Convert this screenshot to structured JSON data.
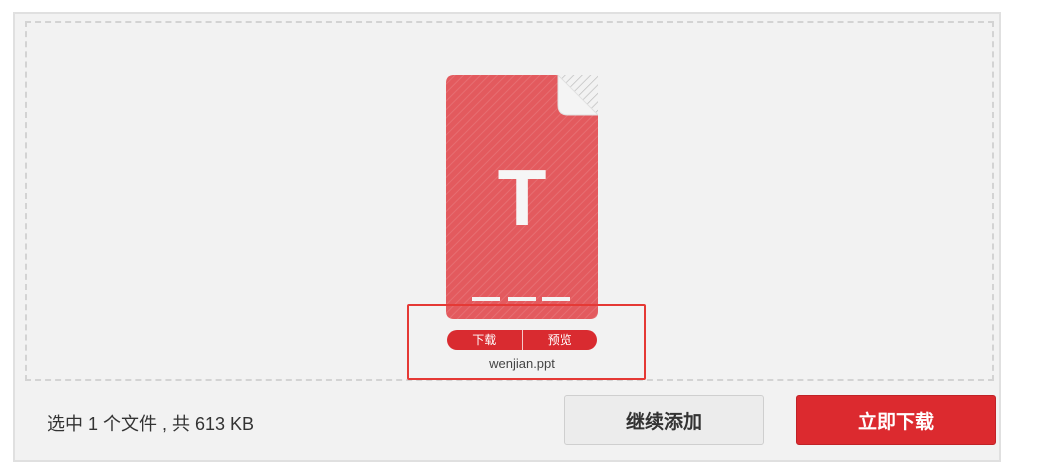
{
  "file": {
    "name": "wenjian.ppt",
    "type_letter": "T",
    "icon": "ppt-file-icon",
    "download_label": "下载",
    "preview_label": "预览"
  },
  "footer": {
    "summary": "选中 1 个文件 , 共 613 KB",
    "continue_label": "继续添加",
    "download_now_label": "立即下载"
  },
  "colors": {
    "file_icon": "#e35a5e",
    "accent_red": "#dc2a2f",
    "highlight_border": "#e53935",
    "panel_bg": "#f2f2f2"
  }
}
